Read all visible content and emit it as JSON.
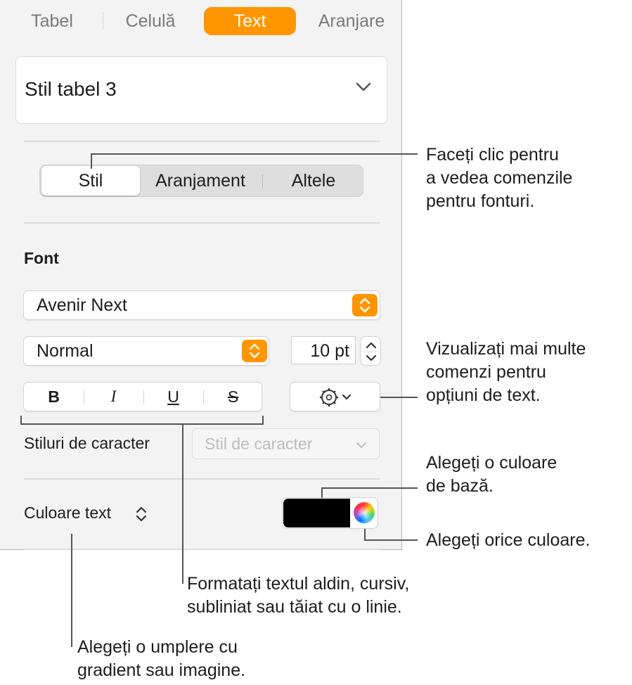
{
  "tabs": [
    {
      "label": "Tabel"
    },
    {
      "label": "Celulă"
    },
    {
      "label": "Text",
      "active": true
    },
    {
      "label": "Aranjare"
    }
  ],
  "table_style": {
    "value": "Stil tabel 3",
    "icon": "chevron-down-icon"
  },
  "segments": [
    {
      "label": "Stil",
      "active": true
    },
    {
      "label": "Aranjament"
    },
    {
      "label": "Altele"
    }
  ],
  "font": {
    "section_label": "Font",
    "family": "Avenir Next",
    "weight": "Normal",
    "size": "10 pt"
  },
  "format_buttons": {
    "bold": "B",
    "italic": "I",
    "underline": "U",
    "strike": "S"
  },
  "options_icon": "gear-icon",
  "character_styles": {
    "label": "Stiluri de caracter",
    "placeholder": "Stil de caracter"
  },
  "text_color": {
    "label": "Culoare text",
    "swatch": "#000000"
  },
  "accent": "#ff9500",
  "callouts": {
    "segment": "Faceți clic pentru\na vedea comenzile\npentru fonturi.",
    "options": "Vizualizați mai multe\ncomenzi pentru\nopțiuni de text.",
    "base_color": "Alegeți o culoare\nde bază.",
    "any_color": "Alegeți orice culoare.",
    "format": "Formatați textul aldin, cursiv,\nsubliniat sau tăiat cu o linie.",
    "fill": "Alegeți o umplere cu\ngradient sau imagine."
  }
}
